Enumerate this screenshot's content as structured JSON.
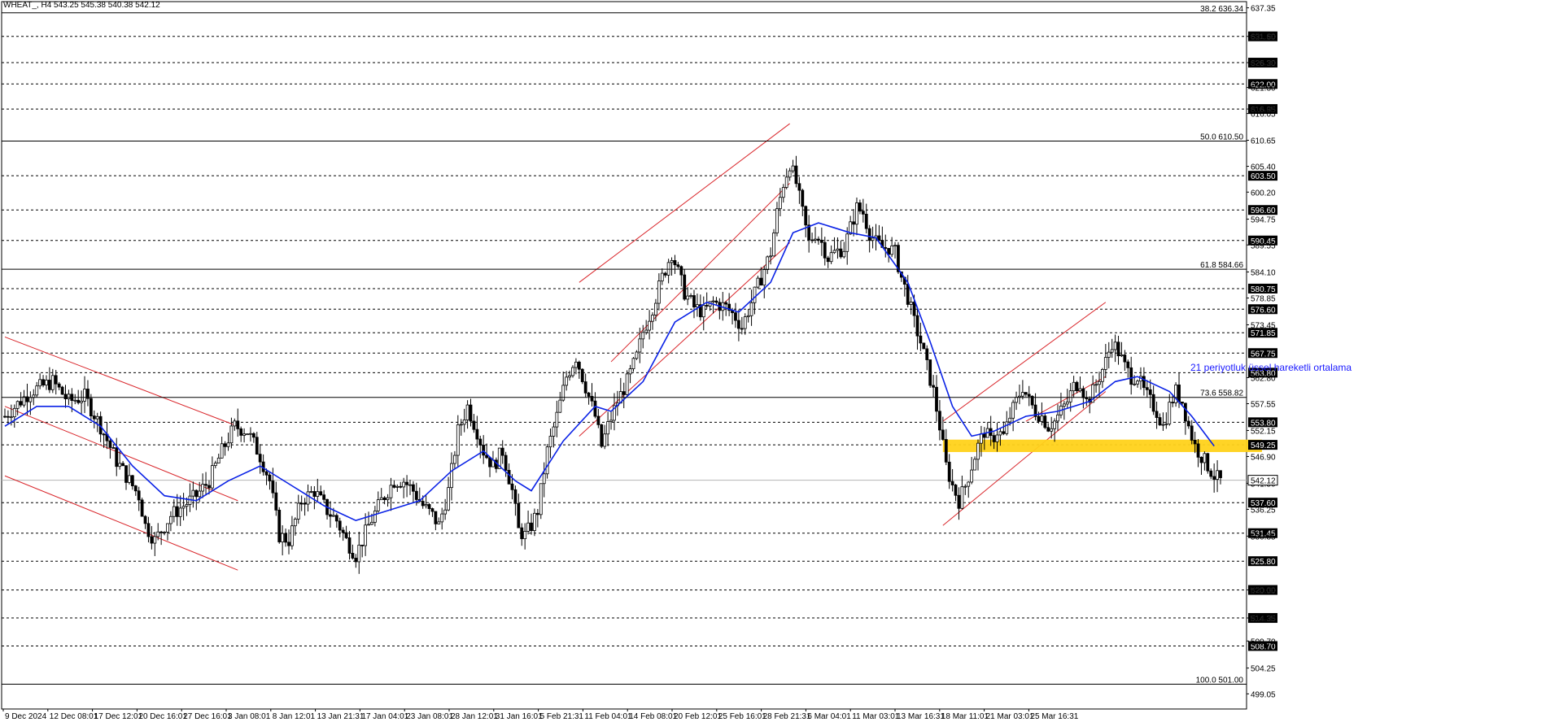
{
  "window": {
    "symbol_line": "WHEAT_, H4  543.25 545.38 540.38 542.12"
  },
  "annotation": {
    "ema_label": "21 periyotluk üssel hareketli ortalama"
  },
  "colors": {
    "up_candle": "#000000",
    "down_candle": "#000000",
    "ema": "#0a22e6",
    "channel": "#d9262b",
    "zone": "#ffd21a",
    "level_box": "#000000",
    "grid": "#000000"
  },
  "chart_data": {
    "type": "candlestick",
    "symbol": "WHEAT_",
    "timeframe": "H4",
    "ohlc_last": {
      "open": 543.25,
      "high": 545.38,
      "low": 540.38,
      "close": 542.12
    },
    "ylim": [
      496.0,
      638.6
    ],
    "y_tick_labels": [
      "637.35",
      "631.60",
      "626.30",
      "621.30",
      "616.95",
      "616.05",
      "610.65",
      "605.40",
      "600.20",
      "594.75",
      "589.55",
      "584.10",
      "578.85",
      "573.45",
      "562.80",
      "557.55",
      "552.15",
      "546.90",
      "541.50",
      "536.25",
      "530.85",
      "520.00",
      "514.35",
      "509.70",
      "504.25",
      "499.05"
    ],
    "x_tick_labels": [
      "9 Dec 2024",
      "12 Dec 08:01",
      "17 Dec 12:01",
      "20 Dec 16:01",
      "27 Dec 16:01",
      "3 Jan 08:01",
      "8 Jan 12:01",
      "13 Jan 21:31",
      "17 Jan 04:01",
      "23 Jan 08:01",
      "28 Jan 12:01",
      "31 Jan 16:01",
      "5 Feb 21:31",
      "11 Feb 04:01",
      "14 Feb 08:01",
      "20 Feb 12:01",
      "25 Feb 16:01",
      "28 Feb 21:31",
      "6 Mar 04:01",
      "11 Mar 03:01",
      "13 Mar 16:31",
      "18 Mar 11:01",
      "21 Mar 03:01",
      "25 Mar 16:31"
    ],
    "horizontal_levels": [
      {
        "value": 631.6,
        "label": "631.60"
      },
      {
        "value": 626.3,
        "label": "626.30"
      },
      {
        "value": 622.0,
        "label": "622.00"
      },
      {
        "value": 616.95,
        "label": "616.95"
      },
      {
        "value": 603.5,
        "label": "603.50"
      },
      {
        "value": 596.6,
        "label": "596.60"
      },
      {
        "value": 590.45,
        "label": "590.45"
      },
      {
        "value": 580.75,
        "label": "580.75"
      },
      {
        "value": 576.6,
        "label": "576.60"
      },
      {
        "value": 571.85,
        "label": "571.85"
      },
      {
        "value": 567.75,
        "label": "567.75"
      },
      {
        "value": 563.8,
        "label": "563.80"
      },
      {
        "value": 553.8,
        "label": "553.80"
      },
      {
        "value": 549.25,
        "label": "549.25"
      },
      {
        "value": 537.6,
        "label": "537.60"
      },
      {
        "value": 531.45,
        "label": "531.45"
      },
      {
        "value": 525.8,
        "label": "525.80"
      },
      {
        "value": 520.0,
        "label": "520.00"
      },
      {
        "value": 514.35,
        "label": "514.35"
      },
      {
        "value": 508.7,
        "label": "508.70"
      }
    ],
    "last_price": {
      "value": 542.12,
      "label": "542.12"
    },
    "fibonacci": [
      {
        "level": "38.2",
        "value": 636.34,
        "label": "38.2 636.34"
      },
      {
        "level": "50.0",
        "value": 610.5,
        "label": "50.0 610.50"
      },
      {
        "level": "61.8",
        "value": 584.66,
        "label": "61.8 584.66"
      },
      {
        "level": "73.6",
        "value": 558.82,
        "label": "73.6 558.82"
      },
      {
        "level": "100.0",
        "value": 501.0,
        "label": "100.0 501.00"
      }
    ],
    "support_zone": {
      "from": 547.8,
      "to": 550.3
    },
    "price_path": [
      [
        0,
        555
      ],
      [
        8,
        560
      ],
      [
        15,
        562
      ],
      [
        20,
        558
      ],
      [
        25,
        559
      ],
      [
        30,
        553
      ],
      [
        35,
        546
      ],
      [
        40,
        541
      ],
      [
        42,
        539
      ],
      [
        44,
        533
      ],
      [
        47,
        530
      ],
      [
        52,
        535
      ],
      [
        56,
        537
      ],
      [
        60,
        539
      ],
      [
        64,
        542
      ],
      [
        68,
        548
      ],
      [
        72,
        553
      ],
      [
        76,
        552
      ],
      [
        80,
        547
      ],
      [
        83,
        542
      ],
      [
        86,
        531
      ],
      [
        89,
        530
      ],
      [
        93,
        538
      ],
      [
        97,
        540
      ],
      [
        101,
        536
      ],
      [
        104,
        534
      ],
      [
        107,
        530
      ],
      [
        110,
        527
      ],
      [
        114,
        533
      ],
      [
        118,
        538
      ],
      [
        122,
        542
      ],
      [
        125,
        542
      ],
      [
        128,
        540
      ],
      [
        131,
        537
      ],
      [
        134,
        535
      ],
      [
        136,
        533
      ],
      [
        139,
        540
      ],
      [
        142,
        552
      ],
      [
        145,
        557
      ],
      [
        148,
        552
      ],
      [
        150,
        548
      ],
      [
        153,
        545
      ],
      [
        156,
        548
      ],
      [
        159,
        540
      ],
      [
        161,
        532
      ],
      [
        163,
        531
      ],
      [
        165,
        533
      ],
      [
        167,
        536
      ],
      [
        170,
        548
      ],
      [
        173,
        555
      ],
      [
        176,
        563
      ],
      [
        179,
        567
      ],
      [
        182,
        561
      ],
      [
        185,
        555
      ],
      [
        187,
        549
      ],
      [
        189,
        553
      ],
      [
        192,
        558
      ],
      [
        195,
        562
      ],
      [
        198,
        567
      ],
      [
        200,
        572
      ],
      [
        203,
        577
      ],
      [
        206,
        583
      ],
      [
        209,
        588
      ],
      [
        211,
        584
      ],
      [
        213,
        580
      ],
      [
        216,
        577
      ],
      [
        219,
        576
      ],
      [
        222,
        578
      ],
      [
        226,
        577
      ],
      [
        229,
        575
      ],
      [
        231,
        573
      ],
      [
        234,
        578
      ],
      [
        237,
        583
      ],
      [
        240,
        588
      ],
      [
        242,
        596
      ],
      [
        244,
        602
      ],
      [
        246,
        606
      ],
      [
        248,
        602
      ],
      [
        250,
        596
      ],
      [
        252,
        590
      ],
      [
        254,
        592
      ],
      [
        256,
        590
      ],
      [
        258,
        587
      ],
      [
        260,
        588
      ],
      [
        263,
        589
      ],
      [
        265,
        593
      ],
      [
        267,
        597
      ],
      [
        269,
        596
      ],
      [
        271,
        592
      ],
      [
        273,
        590
      ],
      [
        275,
        589
      ],
      [
        277,
        589
      ],
      [
        279,
        588
      ],
      [
        281,
        583
      ],
      [
        283,
        579
      ],
      [
        285,
        574
      ],
      [
        287,
        570
      ],
      [
        289,
        565
      ],
      [
        291,
        560
      ],
      [
        293,
        553
      ],
      [
        295,
        545
      ],
      [
        297,
        541
      ],
      [
        299,
        538
      ],
      [
        301,
        541
      ],
      [
        303,
        545
      ],
      [
        305,
        549
      ],
      [
        307,
        552
      ],
      [
        309,
        550
      ],
      [
        311,
        552
      ],
      [
        313,
        551
      ],
      [
        315,
        555
      ],
      [
        317,
        558
      ],
      [
        319,
        561
      ],
      [
        321,
        558
      ],
      [
        323,
        556
      ],
      [
        325,
        555
      ],
      [
        327,
        553
      ],
      [
        329,
        554
      ],
      [
        331,
        556
      ],
      [
        333,
        558
      ],
      [
        335,
        561
      ],
      [
        337,
        562
      ],
      [
        339,
        558
      ],
      [
        341,
        560
      ],
      [
        343,
        563
      ],
      [
        345,
        566
      ],
      [
        347,
        570
      ],
      [
        349,
        568
      ],
      [
        351,
        565
      ],
      [
        353,
        563
      ],
      [
        355,
        563
      ],
      [
        357,
        560
      ],
      [
        359,
        558
      ],
      [
        361,
        556
      ],
      [
        363,
        553
      ],
      [
        365,
        557
      ],
      [
        367,
        560
      ],
      [
        369,
        558
      ],
      [
        371,
        553
      ],
      [
        373,
        549
      ],
      [
        375,
        547
      ],
      [
        377,
        545
      ],
      [
        379,
        543
      ],
      [
        381,
        542
      ]
    ],
    "ema21_path": [
      [
        0,
        553
      ],
      [
        10,
        557
      ],
      [
        20,
        557
      ],
      [
        30,
        553
      ],
      [
        40,
        545
      ],
      [
        50,
        539
      ],
      [
        60,
        538
      ],
      [
        70,
        542
      ],
      [
        80,
        545
      ],
      [
        90,
        541
      ],
      [
        100,
        537
      ],
      [
        110,
        534
      ],
      [
        120,
        536
      ],
      [
        130,
        538
      ],
      [
        140,
        544
      ],
      [
        150,
        548
      ],
      [
        160,
        542
      ],
      [
        165,
        540
      ],
      [
        175,
        550
      ],
      [
        185,
        557
      ],
      [
        190,
        556
      ],
      [
        200,
        562
      ],
      [
        210,
        574
      ],
      [
        220,
        578
      ],
      [
        230,
        576
      ],
      [
        240,
        582
      ],
      [
        247,
        592
      ],
      [
        255,
        594
      ],
      [
        265,
        592
      ],
      [
        273,
        591
      ],
      [
        283,
        582
      ],
      [
        290,
        570
      ],
      [
        297,
        557
      ],
      [
        303,
        551
      ],
      [
        310,
        552
      ],
      [
        320,
        555
      ],
      [
        330,
        556
      ],
      [
        340,
        558
      ],
      [
        348,
        562
      ],
      [
        355,
        563
      ],
      [
        365,
        560
      ],
      [
        372,
        555
      ],
      [
        379,
        549
      ]
    ],
    "channels": [
      {
        "name": "descending",
        "lines": [
          [
            [
              0,
              571
            ],
            [
              73,
              553
            ]
          ],
          [
            [
              0,
              557
            ],
            [
              73,
              538
            ]
          ],
          [
            [
              0,
              543
            ],
            [
              73,
              524
            ]
          ]
        ]
      },
      {
        "name": "rising-1",
        "lines": [
          [
            [
              180,
              582
            ],
            [
              246,
              614
            ]
          ],
          [
            [
              180,
              551
            ],
            [
              246,
              590
            ]
          ],
          [
            [
              190,
              566
            ],
            [
              246,
              602
            ]
          ]
        ]
      },
      {
        "name": "rising-2",
        "lines": [
          [
            [
              294,
              554
            ],
            [
              345,
              578
            ]
          ],
          [
            [
              294,
              533
            ],
            [
              345,
              560
            ]
          ],
          [
            [
              320,
              554
            ],
            [
              345,
              563
            ]
          ]
        ]
      }
    ]
  }
}
